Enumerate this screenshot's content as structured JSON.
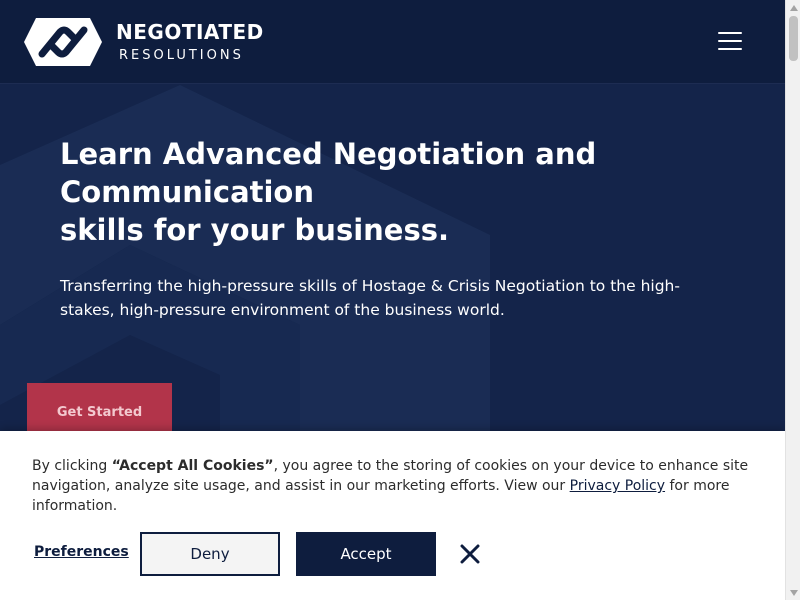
{
  "header": {
    "logo_title": "NEGOTIATED",
    "logo_subtitle": "RESOLUTIONS",
    "menu_icon": "hamburger-menu-icon"
  },
  "hero": {
    "title_lines": [
      "Learn Advanced Negotiation and",
      "Communication",
      "skills for your business."
    ],
    "subtitle": "Transferring the high-pressure skills of Hostage & Crisis Negotiation to the high-stakes, high-pressure environment of the business world.",
    "cta_label": "Get Started"
  },
  "cookie_banner": {
    "text_before": "By clicking ",
    "text_bold": "“Accept All Cookies”",
    "text_middle": ", you agree to the storing of cookies on your device to enhance site navigation, analyze site usage, and assist in our marketing efforts. View our ",
    "privacy_link": "Privacy Policy",
    "text_after": " for more information.",
    "preferences_label": "Preferences",
    "deny_label": "Deny",
    "accept_label": "Accept",
    "close_icon": "close-icon"
  },
  "colors": {
    "header_bg": "#0e1d3e",
    "hero_bg": "#14244a",
    "cta_bg": "#b2344a",
    "accent_navy": "#0e1d3e"
  }
}
